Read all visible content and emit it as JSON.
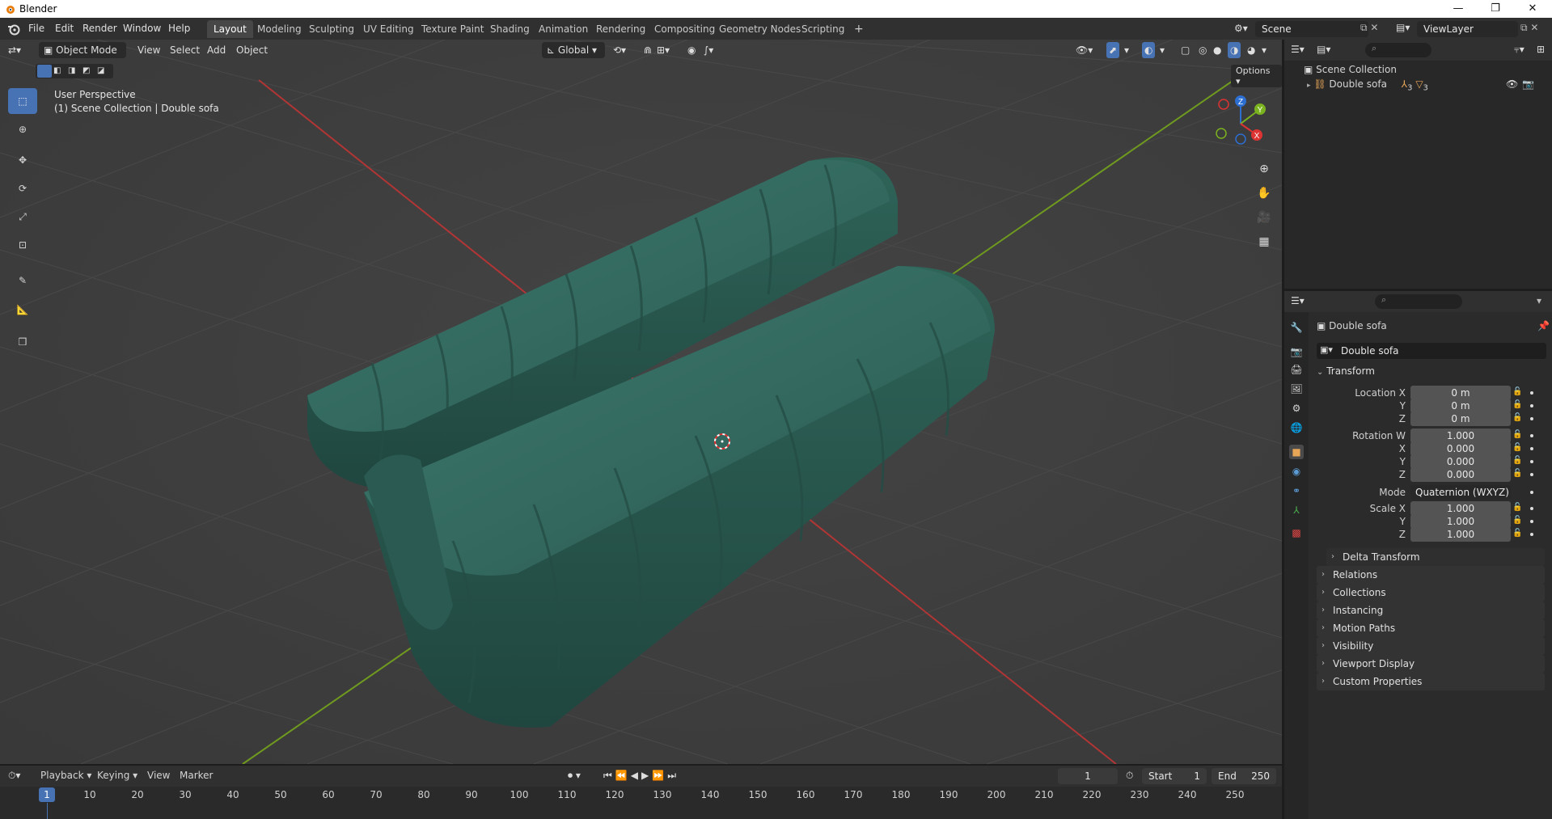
{
  "window": {
    "title": "Blender",
    "min": "—",
    "restore": "❐",
    "close": "✕"
  },
  "menu": [
    "File",
    "Edit",
    "Render",
    "Window",
    "Help"
  ],
  "workspaces": [
    "Layout",
    "Modeling",
    "Sculpting",
    "UV Editing",
    "Texture Paint",
    "Shading",
    "Animation",
    "Rendering",
    "Compositing",
    "Geometry Nodes",
    "Scripting"
  ],
  "active_workspace": "Layout",
  "scene": {
    "name": "Scene",
    "view_layer": "ViewLayer"
  },
  "viewport": {
    "mode": "Object Mode",
    "menus": [
      "View",
      "Select",
      "Add",
      "Object"
    ],
    "orientation": "Global",
    "options_label": "Options",
    "info_line1": "User Perspective",
    "info_line2": "(1) Scene Collection | Double sofa",
    "gizmo": {
      "z": "Z",
      "y": "Y",
      "x": "X"
    }
  },
  "outliner": {
    "root": "Scene Collection",
    "items": [
      {
        "label": "Double sofa",
        "badge": "3",
        "badge2": "3"
      }
    ]
  },
  "properties": {
    "object_name": "Double sofa",
    "data_name": "Double sofa",
    "transform_label": "Transform",
    "location": {
      "label": "Location X",
      "x": "0 m",
      "y": "0 m",
      "z": "0 m"
    },
    "rotation": {
      "label": "Rotation W",
      "w": "1.000",
      "x": "0.000",
      "y": "0.000",
      "z": "0.000"
    },
    "mode_label": "Mode",
    "mode_value": "Quaternion (WXYZ)",
    "scale": {
      "label": "Scale X",
      "x": "1.000",
      "y": "1.000",
      "z": "1.000"
    },
    "axis_y": "Y",
    "axis_z": "Z",
    "axis_x": "X",
    "subpanels": [
      "Delta Transform"
    ],
    "panels": [
      "Relations",
      "Collections",
      "Instancing",
      "Motion Paths",
      "Visibility",
      "Viewport Display",
      "Custom Properties"
    ]
  },
  "timeline": {
    "menus": [
      "Playback",
      "Keying",
      "View",
      "Marker"
    ],
    "current_frame": "1",
    "start_label": "Start",
    "start_value": "1",
    "end_label": "End",
    "end_value": "250",
    "ruler": [
      "1",
      "10",
      "20",
      "30",
      "40",
      "50",
      "60",
      "70",
      "80",
      "90",
      "100",
      "110",
      "120",
      "130",
      "140",
      "150",
      "160",
      "170",
      "180",
      "190",
      "200",
      "210",
      "220",
      "230",
      "240",
      "250"
    ]
  },
  "colors": {
    "accent": "#4772b3",
    "sofa": "#2f5e55",
    "x_axis": "#c23a3a",
    "y_axis": "#6f9a1f"
  }
}
